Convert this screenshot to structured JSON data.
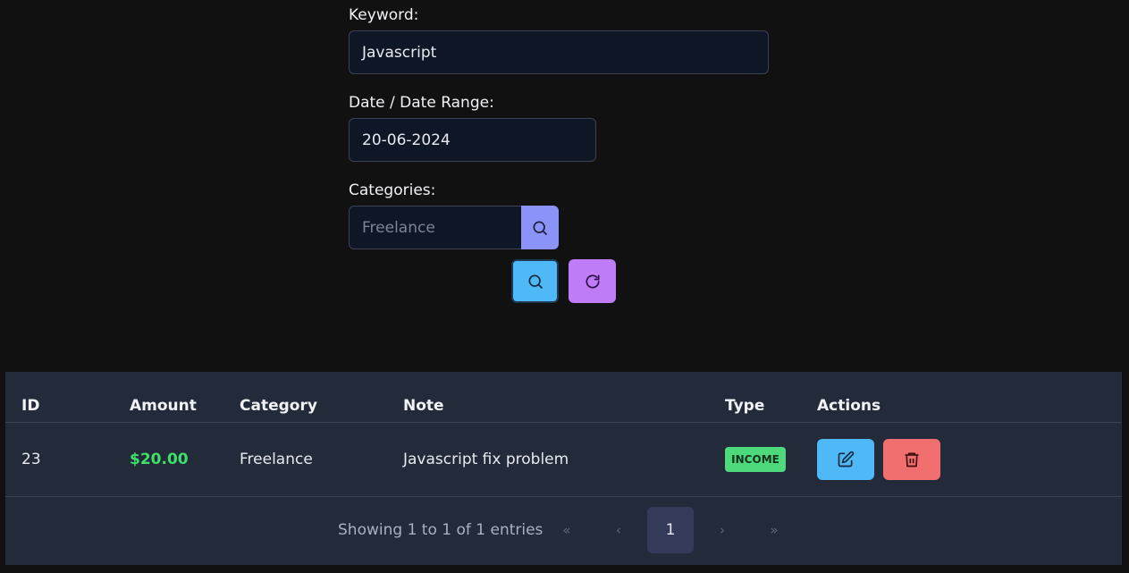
{
  "filters": {
    "keyword_label": "Keyword:",
    "keyword_value": "Javascript",
    "date_label": "Date / Date Range:",
    "date_value": "20-06-2024",
    "categories_label": "Categories:",
    "categories_placeholder": "Freelance"
  },
  "table": {
    "headers": [
      "ID",
      "Amount",
      "Category",
      "Note",
      "Type",
      "Actions"
    ],
    "rows": [
      {
        "id": "23",
        "amount": "$20.00",
        "category": "Freelance",
        "note": "Javascript fix problem",
        "type": "INCOME"
      }
    ]
  },
  "pagination": {
    "info": "Showing 1 to 1 of 1 entries",
    "first": "«",
    "prev": "‹",
    "current": "1",
    "next": "›",
    "last": "»"
  },
  "icons": {
    "category_search": "search-icon",
    "search": "search-icon",
    "reset": "refresh-icon",
    "edit": "edit-icon",
    "delete": "trash-icon"
  },
  "colors": {
    "search_button": "#4fb9f7",
    "reset_button": "#c07cf7",
    "category_button": "#8b93f8",
    "amount_text": "#3ee06a",
    "income_badge": "#4ed97c",
    "delete_button": "#f16f6f"
  }
}
